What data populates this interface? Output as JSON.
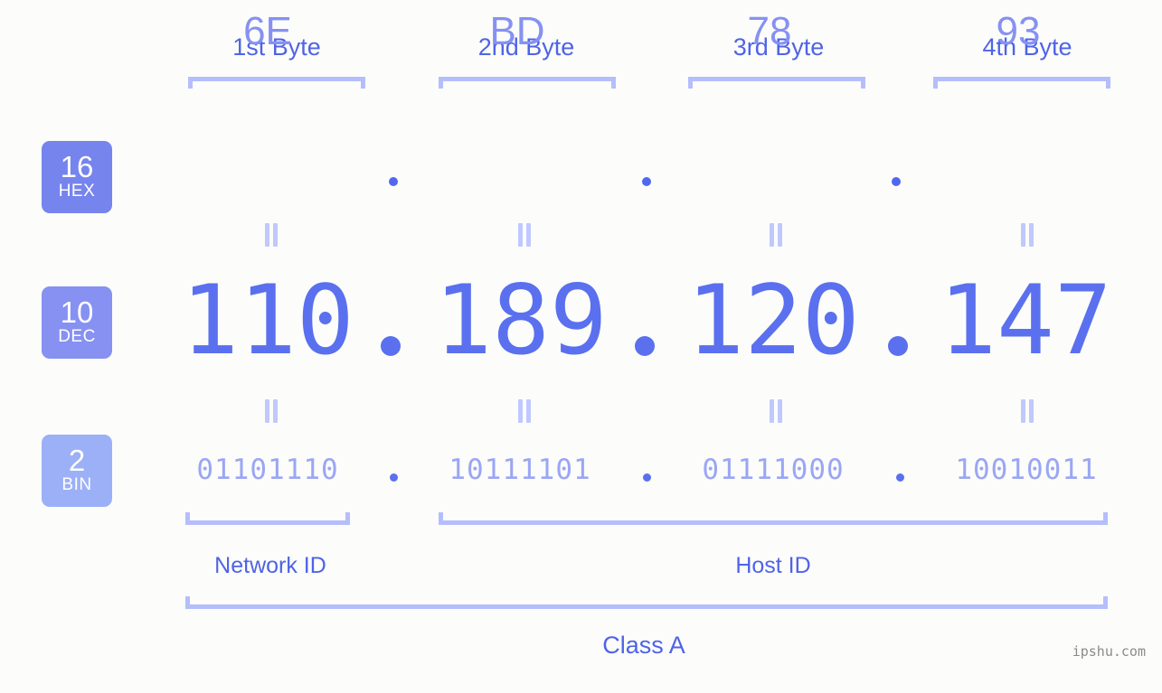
{
  "page": {
    "background_color": "#fcfdfa",
    "accent_color": "#5a70ef",
    "bracket_color": "#b5befc",
    "watermark": "ipshu.com"
  },
  "byte_headers": [
    {
      "label": "1st Byte"
    },
    {
      "label": "2nd Byte"
    },
    {
      "label": "3rd Byte"
    },
    {
      "label": "4th Byte"
    }
  ],
  "bases": [
    {
      "number": "16",
      "name": "HEX",
      "color": "#7684ee"
    },
    {
      "number": "10",
      "name": "DEC",
      "color": "#8691f2"
    },
    {
      "number": "2",
      "name": "BIN",
      "color": "#9cb0f7"
    }
  ],
  "rows": {
    "hex": {
      "values": [
        "6E",
        "BD",
        "78",
        "93"
      ],
      "separator": "."
    },
    "dec": {
      "values": [
        "110",
        "189",
        "120",
        "147"
      ],
      "separator": "."
    },
    "bin": {
      "values": [
        "01101110",
        "10111101",
        "01111000",
        "10010011"
      ],
      "separator": "."
    }
  },
  "equals_symbol": "=",
  "segments": {
    "network_id": "Network ID",
    "host_id": "Host ID"
  },
  "ip_class": "Class A"
}
